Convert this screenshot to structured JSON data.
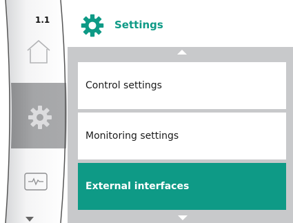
{
  "rail": {
    "screen_number": "1.1",
    "items": [
      {
        "icon": "home-icon"
      },
      {
        "icon": "settings-gear-icon"
      },
      {
        "icon": "monitor-wave-icon"
      }
    ]
  },
  "header": {
    "title": "Settings",
    "icon": "gear-icon"
  },
  "menu": {
    "items": [
      {
        "label": "Control settings"
      },
      {
        "label": "Monitoring settings"
      },
      {
        "label": "External interfaces"
      }
    ],
    "selected_index": 2
  },
  "colors": {
    "accent": "#0e9a86",
    "rail_selected": "#9a9b9d",
    "menu_background": "#c8c9cb"
  }
}
